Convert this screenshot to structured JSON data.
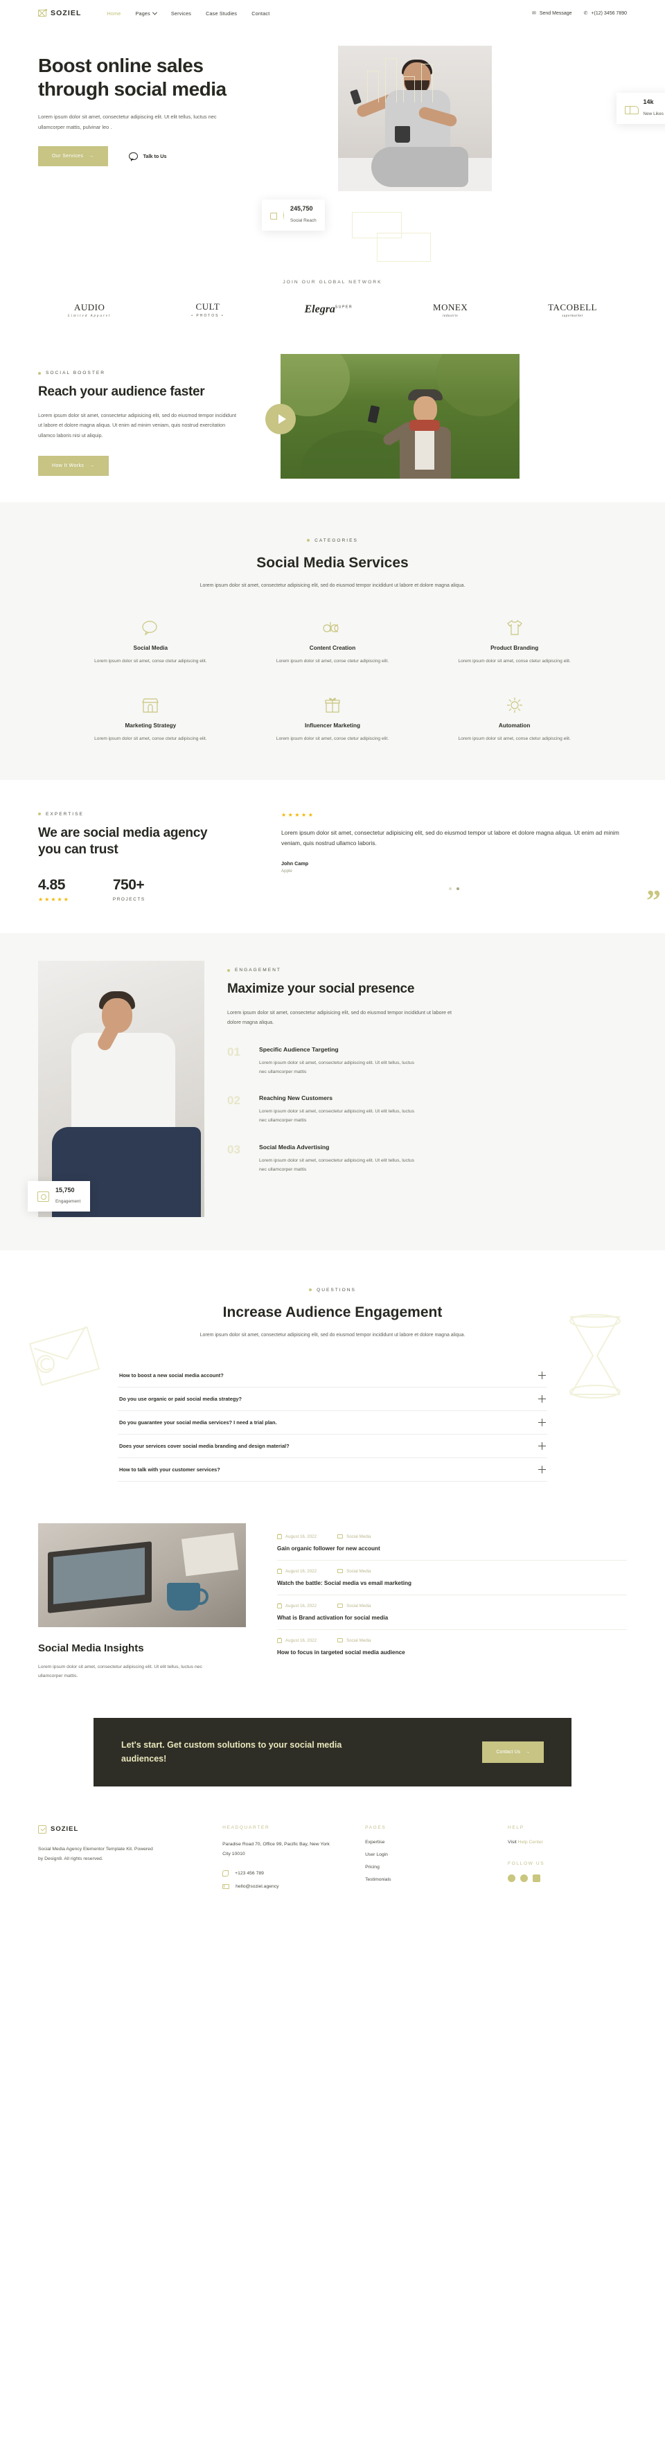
{
  "header": {
    "brand": "SOZIEL",
    "nav": [
      {
        "label": "Home",
        "active": true,
        "caret": false
      },
      {
        "label": "Pages",
        "active": false,
        "caret": true
      },
      {
        "label": "Services",
        "active": false,
        "caret": false
      },
      {
        "label": "Case Studies",
        "active": false,
        "caret": false
      },
      {
        "label": "Contact",
        "active": false,
        "caret": false
      }
    ],
    "send_message": "Send Message",
    "phone": "+(12) 3456 7890"
  },
  "hero": {
    "title": "Boost online sales through social media",
    "paragraph": "Lorem ipsum dolor sit amet, consectetur adipiscing elit. Ut elit tellus, luctus nec ullamcorper mattis, pulvinar leo .",
    "primary_button": "Our Services",
    "secondary_link": "Talk to Us",
    "badges": [
      {
        "value": "14k",
        "label": "New Likes",
        "icon": "thumbs-up-icon"
      },
      {
        "value": "245,750",
        "label": "Social Reach",
        "icon": "megaphone-icon"
      }
    ]
  },
  "partners": {
    "eyebrow": "JOIN OUR GLOBAL NETWORK",
    "logos": [
      {
        "main": "AUDIO",
        "sub": "Limited Apparel"
      },
      {
        "main": "CULT",
        "sub": "• PHOTOS •"
      },
      {
        "main": "Elegra",
        "sup": "SUPER",
        "sub": ""
      },
      {
        "main": "MONEX",
        "sub": "industrie"
      },
      {
        "main": "TACOBELL",
        "sub": "supermarket"
      }
    ]
  },
  "booster": {
    "eyebrow": "SOCIAL BOOSTER",
    "title": "Reach your audience faster",
    "paragraph": "Lorem ipsum dolor sit amet, consectetur adipisicing elit, sed do eiusmod tempor incididunt ut labore et dolore magna aliqua. Ut enim ad minim veniam, quis nostrud exercitation ullamco laboris nisi ut aliquip.",
    "button": "How It Works"
  },
  "services": {
    "eyebrow": "CATEGORIES",
    "title": "Social Media Services",
    "lead": "Lorem ipsum dolor sit amet, consectetur adipisicing elit, sed do eiusmod tempor incididunt ut labore et dolore magna aliqua.",
    "items": [
      {
        "icon": "chat-bubble-icon",
        "title": "Social Media",
        "desc": "Lorem ipsum dolor sit amet, conse ctetur adipiscing elit."
      },
      {
        "icon": "abc-text-icon",
        "title": "Content Creation",
        "desc": "Lorem ipsum dolor sit amet, conse ctetur adipiscing elit."
      },
      {
        "icon": "tshirt-icon",
        "title": "Product Branding",
        "desc": "Lorem ipsum dolor sit amet, conse ctetur adipiscing elit."
      },
      {
        "icon": "storefront-icon",
        "title": "Marketing Strategy",
        "desc": "Lorem ipsum dolor sit amet, conse ctetur adipiscing elit."
      },
      {
        "icon": "gift-box-icon",
        "title": "Influencer Marketing",
        "desc": "Lorem ipsum dolor sit amet, conse ctetur adipiscing elit."
      },
      {
        "icon": "gear-automation-icon",
        "title": "Automation",
        "desc": "Lorem ipsum dolor sit amet, conse ctetur adipiscing elit."
      }
    ]
  },
  "expertise": {
    "eyebrow": "EXPERTISE",
    "title": "We are social media agency you can trust",
    "stats": [
      {
        "value": "4.85",
        "stars": "★★★★★",
        "caption": ""
      },
      {
        "value": "750+",
        "stars": "",
        "caption": "PROJECTS"
      }
    ],
    "testimonial": {
      "stars": "★★★★★",
      "quote": "Lorem ipsum dolor sit amet, consectetur adipisicing elit, sed do eiusmod tempor ut labore et dolore magna aliqua. Ut enim ad minim veniam, quis nostrud ullamco laboris.",
      "name": "John Camp",
      "role": "Apple"
    }
  },
  "engagement": {
    "eyebrow": "ENGAGEMENT",
    "title": "Maximize your social presence",
    "paragraph": "Lorem ipsum dolor sit amet, consectetur adipisicing elit, sed do eiusmod tempor incididunt ut labore et dolore magna aliqua.",
    "badge": {
      "value": "15,750",
      "label": "Engagement",
      "icon": "people-card-icon"
    },
    "steps": [
      {
        "num": "01",
        "title": "Specific Audience Targeting",
        "desc": "Lorem ipsum dolor sit amet, consectetur adipiscing elit. Ut elit tellus, luctus nec ullamcorper mattis"
      },
      {
        "num": "02",
        "title": "Reaching New Customers",
        "desc": "Lorem ipsum dolor sit amet, consectetur adipiscing elit. Ut elit tellus, luctus nec ullamcorper mattis"
      },
      {
        "num": "03",
        "title": "Social Media Advertising",
        "desc": "Lorem ipsum dolor sit amet, consectetur adipiscing elit. Ut elit tellus, luctus nec ullamcorper mattis"
      }
    ]
  },
  "faq": {
    "eyebrow": "QUESTIONS",
    "title": "Increase Audience Engagement",
    "lead": "Lorem ipsum dolor sit amet, consectetur adipisicing elit, sed do eiusmod tempor incididunt ut labore et dolore magna aliqua.",
    "items": [
      "How to boost a new social media account?",
      "Do you use organic or paid social media strategy?",
      "Do you guarantee your social media services? I need a trial plan.",
      "Does your services cover social media branding and design material?",
      "How to talk with your customer services?"
    ]
  },
  "blog": {
    "title": "Social Media Insights",
    "paragraph": "Lorem ipsum dolor sit amet, consectetur adipiscing elit. Ut elit tellus, luctus nec ullamcorper mattis.",
    "posts": [
      {
        "date": "August 16, 2022",
        "category": "Social Media",
        "title": "Gain organic follower for new account"
      },
      {
        "date": "August 16, 2022",
        "category": "Social Media",
        "title": "Watch the battle: Social media vs email marketing"
      },
      {
        "date": "August 16, 2022",
        "category": "Social Media",
        "title": "What is Brand activation for social media"
      },
      {
        "date": "August 16, 2022",
        "category": "Social Media",
        "title": "How to focus in targeted social media audience"
      }
    ]
  },
  "cta": {
    "heading": "Let's start. Get custom solutions to your social media audiences!",
    "button": "Contact Us"
  },
  "footer": {
    "brand": "SOZIEL",
    "about": "Social Media Agency Elementor Template Kit. Powered by Design8. All rights reserved.",
    "headquarter": {
      "heading": "HEADQUARTER",
      "address": "Paradise Road 70, Office 99, Pacific Bay,  New York City 10010",
      "phone": "+123 456 789",
      "email": "hello@soziel.agency"
    },
    "pages": {
      "heading": "PAGES",
      "links": [
        "Expertise",
        "User Login",
        "Pricing",
        "Testimonials"
      ]
    },
    "help": {
      "heading": "HELP",
      "visit_prefix": "Visit",
      "visit_link": "Help Center",
      "follow_heading": "FOLLOW US",
      "socials": [
        "facebook-icon",
        "twitter-icon",
        "youtube-icon"
      ]
    }
  },
  "colors": {
    "accent": "#c7c484",
    "dark": "#2e2d26",
    "star": "#f2b705",
    "muted": "#6a6a63"
  }
}
